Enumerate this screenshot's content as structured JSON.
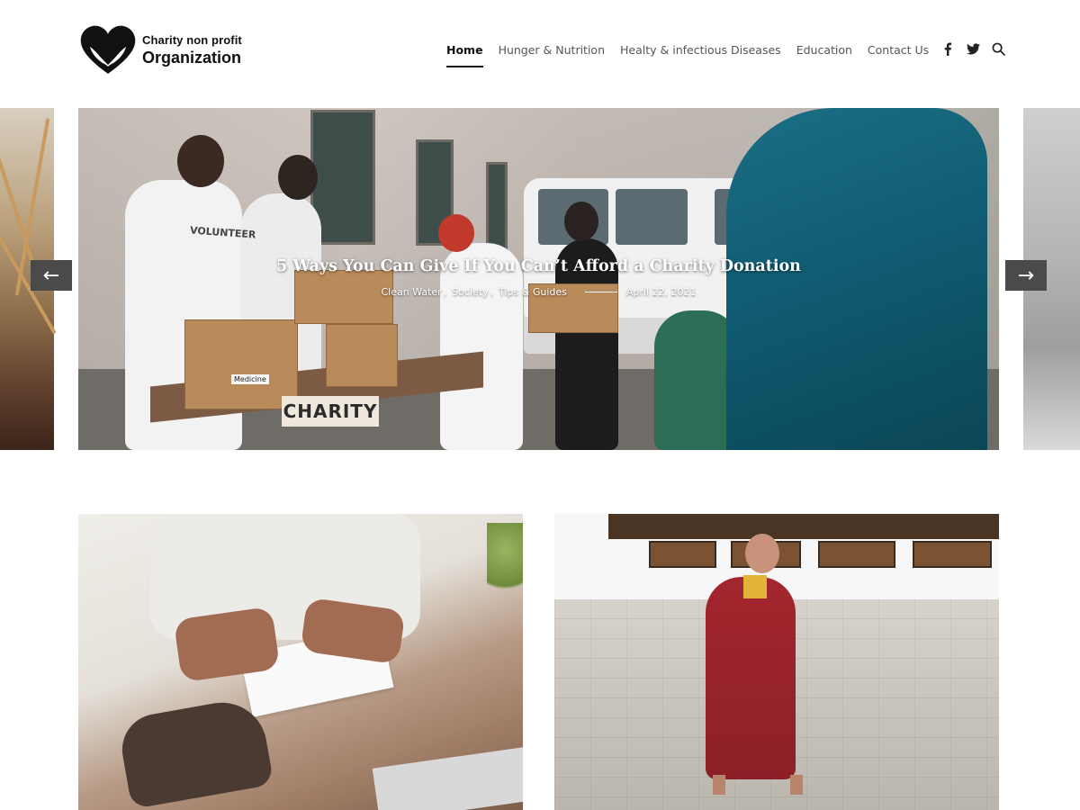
{
  "brand": {
    "line1": "Charity non profit",
    "line2": "Organization"
  },
  "nav": {
    "items": [
      {
        "label": "Home",
        "active": true
      },
      {
        "label": "Hunger & Nutrition",
        "active": false
      },
      {
        "label": "Healty & infectious Diseases",
        "active": false
      },
      {
        "label": "Education",
        "active": false
      },
      {
        "label": "Contact Us",
        "active": false
      }
    ]
  },
  "social": {
    "icons": [
      "facebook-icon",
      "twitter-icon",
      "search-icon"
    ]
  },
  "slider": {
    "title": "5 Ways You Can Give If You Can’t Afford a Charity Donation",
    "categories": [
      "Clean Water",
      "Society",
      "Tips & Guides"
    ],
    "separator": ",",
    "date": "April 22, 2021",
    "prev_label": "←",
    "next_label": "→",
    "image_texts": {
      "sign": "CHARITY",
      "shirt": "VOLUNTEER",
      "box_label": "Medicine"
    }
  },
  "colors": {
    "nav_active": "#111111",
    "nav_text": "#555555",
    "arrow_bg": "#4a4a4a"
  }
}
